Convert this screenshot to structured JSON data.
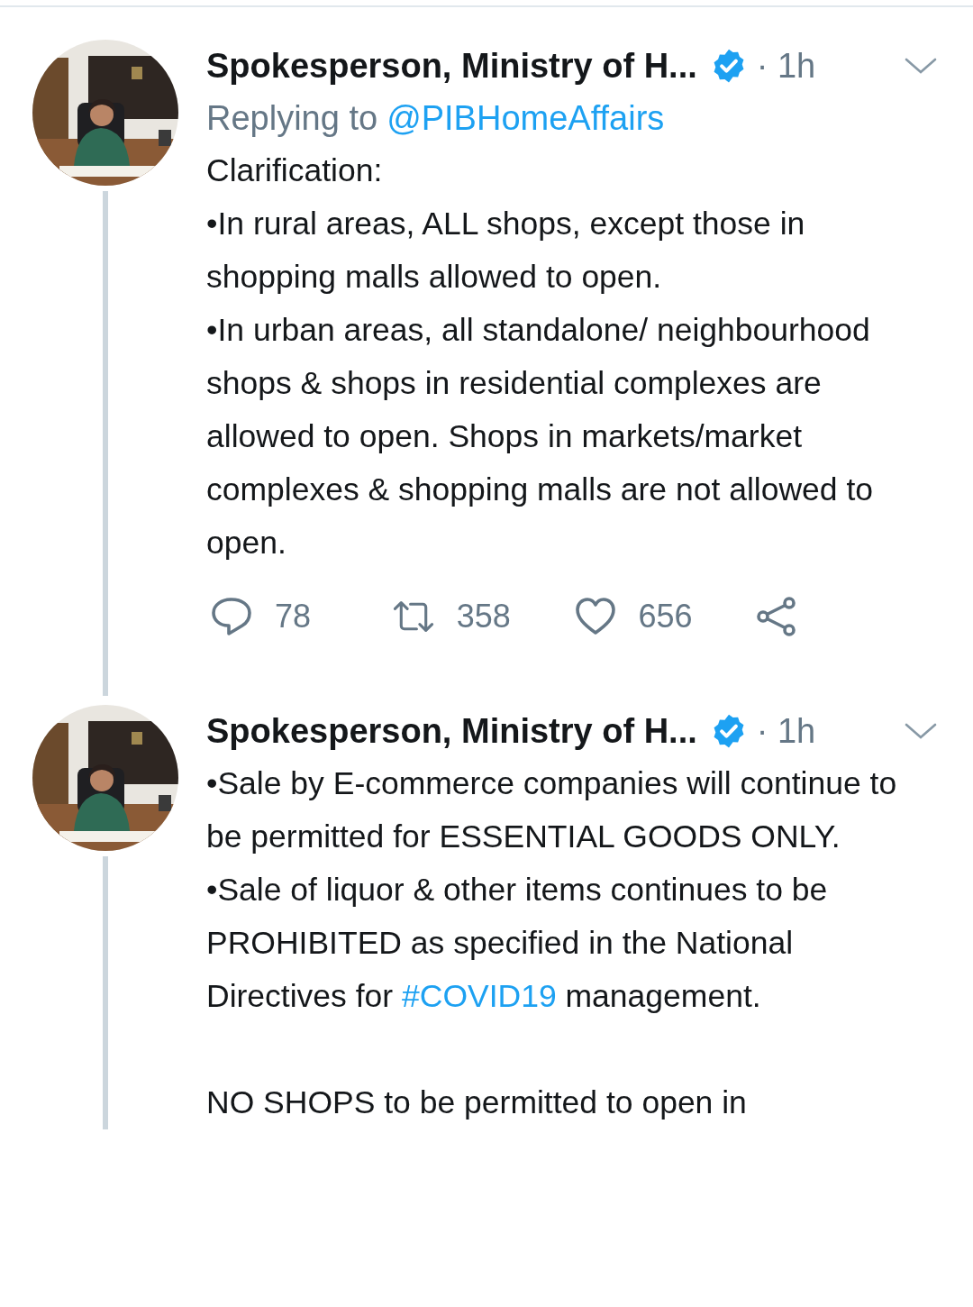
{
  "tweets": [
    {
      "name": "Spokesperson, Ministry of H...",
      "time": "· 1h",
      "replying_to": {
        "label": "Replying to",
        "handle": "@PIBHomeAffairs"
      },
      "paragraphs": [
        [
          {
            "kind": "text",
            "text": "Clarification:"
          }
        ],
        [
          {
            "kind": "text",
            "text": "•In rural areas, ALL shops, except those in shopping malls allowed to open."
          }
        ],
        [
          {
            "kind": "text",
            "text": "•In urban areas, all standalone/ neighbourhood shops & shops in residential complexes are allowed to open. Shops in markets/market complexes & shopping malls are not allowed to open."
          }
        ]
      ],
      "actions": [
        {
          "kind": "reply",
          "count": "78"
        },
        {
          "kind": "retweet",
          "count": "358"
        },
        {
          "kind": "like",
          "count": "656"
        },
        {
          "kind": "share"
        }
      ]
    },
    {
      "name": "Spokesperson, Ministry of H...",
      "time": "· 1h",
      "paragraphs": [
        [
          {
            "kind": "text",
            "text": "•Sale by E-commerce companies will continue to be permitted for ESSENTIAL GOODS ONLY."
          }
        ],
        [
          {
            "kind": "text",
            "text": "•Sale of liquor & other items continues to be PROHIBITED as specified in the National Directives for "
          },
          {
            "kind": "hashtag",
            "text": "#COVID19"
          },
          {
            "kind": "text",
            "text": " management.\n\nNO SHOPS to be permitted to open in"
          }
        ]
      ]
    }
  ]
}
